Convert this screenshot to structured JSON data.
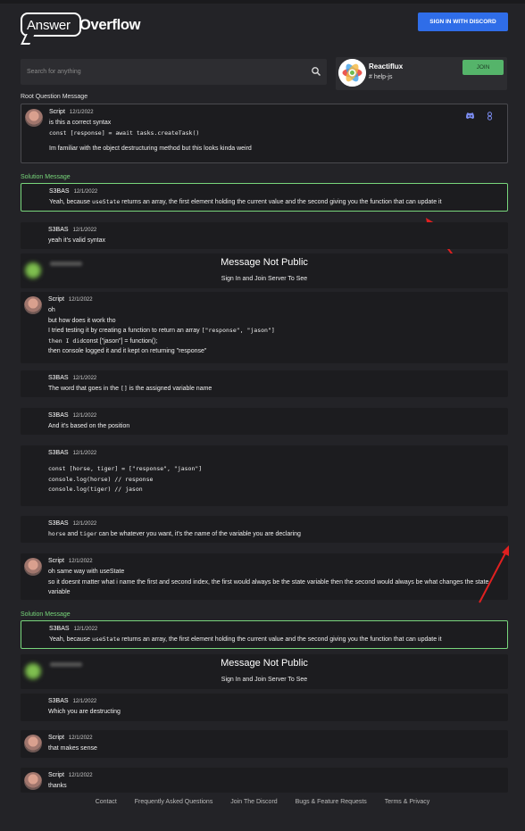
{
  "header": {
    "logo_answer": "Answer",
    "logo_overflow": "Overflow",
    "signin_label": "SIGN IN WITH DISCORD"
  },
  "search": {
    "placeholder": "Search for anything"
  },
  "server": {
    "name": "Reactiflux",
    "channel": "# help-js",
    "join_label": "JOIN"
  },
  "root_label": "Root Question Message",
  "root": {
    "author": "Script",
    "date": "12/1/2022",
    "line1": "is this a correct syntax",
    "line2": "const [response] = await tasks.createTask()",
    "line3": "Im familiar with the object destructuring method but this looks kinda weird"
  },
  "solution_label": "Solution Message",
  "solution": {
    "author": "S3BAS",
    "date": "12/1/2022",
    "text_a": "Yeah, because ",
    "code": "useState",
    "text_b": " returns an array, the first element holding the current value and the second giving you the function that can update it"
  },
  "msg_valid": {
    "author": "S3BAS",
    "date": "12/1/2022",
    "text": "yeah it's valid syntax"
  },
  "not_public": {
    "title": "Message Not Public",
    "subtitle": "Sign In and Join Server To See"
  },
  "msg_how": {
    "author": "Script",
    "date": "12/1/2022",
    "l1": "oh",
    "l2": "but how does it work tho",
    "l3a": "I tried testing it by creating a function to return an array ",
    "l3b": "[\"response\", \"jason\"]",
    "l4a": "then I did",
    "l4b": "const [\"jason\"] = function();",
    "l5": "then console logged it and it kept on returning \"response\""
  },
  "msg_word": {
    "author": "S3BAS",
    "date": "12/1/2022",
    "a": "The word that goes in the ",
    "code": "[]",
    "b": " is the assigned variable name"
  },
  "msg_position": {
    "author": "S3BAS",
    "date": "12/1/2022",
    "text": "And it's based on the position"
  },
  "msg_code": {
    "author": "S3BAS",
    "date": "12/1/2022",
    "c1": "const [horse, tiger] = [\"response\", \"jason\"]",
    "c2": "console.log(horse) // response",
    "c3": "console.log(tiger) // jason"
  },
  "msg_whatever": {
    "author": "S3BAS",
    "date": "12/1/2022",
    "c1": "horse",
    "a": " and ",
    "c2": "tiger",
    "b": " can be whatever you want, it's the name of the variable you are declaring"
  },
  "msg_same": {
    "author": "Script",
    "date": "12/1/2022",
    "l1": "oh same way with useState",
    "l2": "so it doesnt matter what i name the first and second index, the first would always be the state variable then the second would always be what changes the state variable"
  },
  "msg_destruct": {
    "author": "S3BAS",
    "date": "12/1/2022",
    "text": "Which you are destructing"
  },
  "msg_sense": {
    "author": "Script",
    "date": "12/1/2022",
    "text": "that makes sense"
  },
  "msg_thanks": {
    "author": "Script",
    "date": "12/1/2022",
    "text": "thanks"
  },
  "footer": {
    "contact": "Contact",
    "faq": "Frequently Asked Questions",
    "discord": "Join The Discord",
    "bugs": "Bugs & Feature Requests",
    "terms": "Terms & Privacy"
  },
  "colors": {
    "accent_blue": "#2f6de8",
    "solution_green": "#78d67c",
    "join_green": "#55b46a",
    "arrow_red": "#e02020"
  }
}
